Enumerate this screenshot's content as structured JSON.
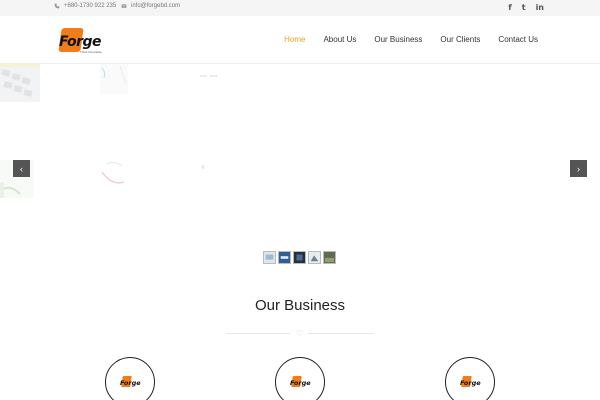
{
  "topbar": {
    "phone": "+880-1730 922 235",
    "email": "info@forgebd.com",
    "social": [
      {
        "icon": "facebook-icon",
        "glyph": "f"
      },
      {
        "icon": "twitter-icon",
        "glyph": "t"
      },
      {
        "icon": "linkedin-icon",
        "glyph": "in"
      }
    ]
  },
  "brand": {
    "logo_text": "Forge",
    "tagline": "Think Innovative",
    "accent_color": "#f07d1a"
  },
  "nav": {
    "items": [
      {
        "label": "Home",
        "active": true
      },
      {
        "label": "About Us",
        "active": false
      },
      {
        "label": "Our Business",
        "active": false
      },
      {
        "label": "Our Clients",
        "active": false
      },
      {
        "label": "Contact Us",
        "active": false
      }
    ],
    "active_color": "#f0a028"
  },
  "slider": {
    "prev_icon": "chevron-left-icon",
    "next_icon": "chevron-right-icon",
    "prev_glyph": "‹",
    "next_glyph": "›",
    "thumbnail_count": 5
  },
  "business": {
    "title": "Our Business",
    "divider_icon": "heart-icon",
    "divider_glyph": "♡",
    "cards": [
      {
        "logo_text": "Forge"
      },
      {
        "logo_text": "Forge"
      },
      {
        "logo_text": "Forge"
      }
    ]
  }
}
